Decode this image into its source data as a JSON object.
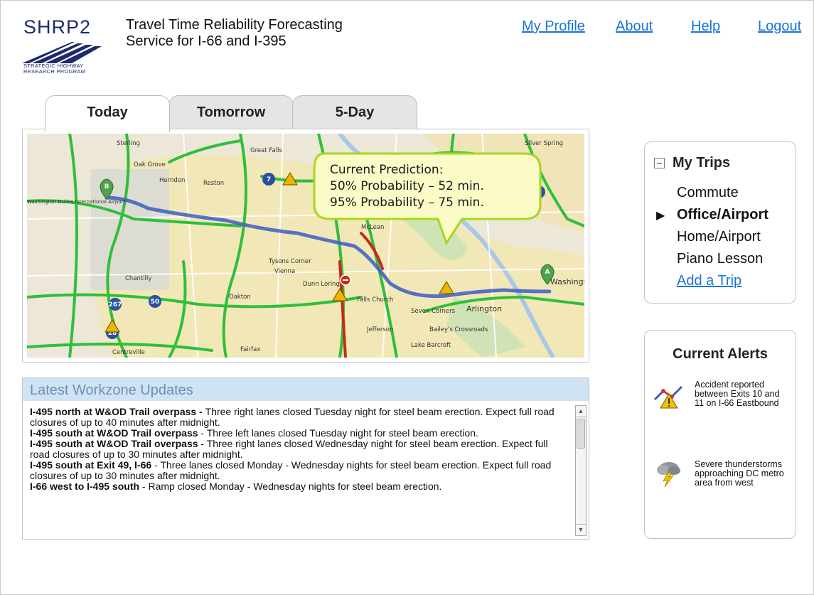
{
  "header": {
    "logo_text": "SHRP2",
    "logo_caption_line1": "STRATEGIC HIGHWAY",
    "logo_caption_line2": "RESEARCH PROGRAM",
    "title_line1": "Travel Time Reliability Forecasting",
    "title_line2": "Service for I-66 and I-395",
    "links": {
      "profile": "My Profile",
      "about": "About",
      "help": "Help",
      "logout": "Logout"
    }
  },
  "tabs": {
    "today": "Today",
    "tomorrow": "Tomorrow",
    "fiveday": "5-Day",
    "active": "Today"
  },
  "map": {
    "prediction_title": "Current Prediction:",
    "prediction_50": "50% Probability – 52 min.",
    "prediction_95": "95% Probability – 75 min.",
    "labels": {
      "sterling": "Sterling",
      "great_falls": "Great Falls",
      "silver_spring": "Silver Spring",
      "oak_grove": "Oak Grove",
      "herndon": "Herndon",
      "reston": "Reston",
      "dulles": "Washington Dulles International Airport",
      "mclean": "McLean",
      "vienna": "Vienna",
      "chantilly": "Chantilly",
      "oakton": "Oakton",
      "dunn_loring": "Dunn Loring",
      "falls_church": "Falls Church",
      "arlington": "Arlington",
      "washington_dc": "Washington DC",
      "jefferson": "Jefferson",
      "baileys": "Bailey's Crossroads",
      "fairfax": "Fairfax",
      "centreville": "Centreville",
      "tysons": "Tysons Corner",
      "seven_corners": "Seven Corners",
      "lake_barcroft": "Lake Barcroft"
    },
    "marker_a": "A",
    "marker_b": "B"
  },
  "workzone": {
    "title": "Latest Workzone Updates",
    "items": [
      {
        "bold": "I-495 north at W&OD Trail overpass - ",
        "text": "Three right lanes closed Tuesday night for steel beam erection. Expect full road closures of up to 40 minutes after midnight."
      },
      {
        "bold": "I-495 south at W&OD Trail overpass",
        "text": " - Three left lanes closed Tuesday night for steel beam erection."
      },
      {
        "bold": "I-495 south at W&OD Trail overpass",
        "text": " - Three right lanes closed Wednesday night for steel beam erection. Expect full road closures of up to 30 minutes after midnight."
      },
      {
        "bold": "I-495 south at Exit 49, I-66",
        "text": " - Three lanes closed Monday - Wednesday nights for steel beam erection. Expect full road closures of up to 30 minutes after midnight."
      },
      {
        "bold": "I-66 west to I-495 south",
        "text": " - Ramp closed Monday - Wednesday nights for steel beam erection."
      }
    ]
  },
  "trips": {
    "title": "My Trips",
    "items": [
      "Commute",
      "Office/Airport",
      "Home/Airport",
      "Piano Lesson"
    ],
    "selected": "Office/Airport",
    "add_label": "Add a Trip"
  },
  "alerts": {
    "title": "Current Alerts",
    "items": [
      {
        "icon": "accident-warning-icon",
        "text": "Accident reported between Exits 10 and 11 on I-66 Eastbound"
      },
      {
        "icon": "thunderstorm-icon",
        "text": "Severe thunderstorms approaching DC metro area from west"
      }
    ]
  },
  "colors": {
    "link": "#1a73d8",
    "route": "#3c5cc4",
    "traffic_green": "#2fbf3b",
    "traffic_red": "#c8281d",
    "callout_fill": "#fafbc6",
    "callout_border": "#a5d81f",
    "workzone_header": "#cfe3f5"
  }
}
